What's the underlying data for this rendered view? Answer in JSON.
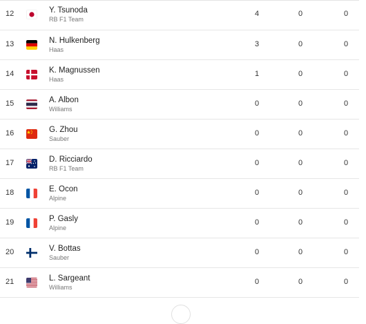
{
  "standings": {
    "rows": [
      {
        "pos": "12",
        "flag": "japan-flag-icon",
        "driver": "Y. Tsunoda",
        "team": "RB F1 Team",
        "s1": "4",
        "s2": "0",
        "s3": "0"
      },
      {
        "pos": "13",
        "flag": "germany-flag-icon",
        "driver": "N. Hulkenberg",
        "team": "Haas",
        "s1": "3",
        "s2": "0",
        "s3": "0"
      },
      {
        "pos": "14",
        "flag": "denmark-flag-icon",
        "driver": "K. Magnussen",
        "team": "Haas",
        "s1": "1",
        "s2": "0",
        "s3": "0"
      },
      {
        "pos": "15",
        "flag": "thailand-flag-icon",
        "driver": "A. Albon",
        "team": "Williams",
        "s1": "0",
        "s2": "0",
        "s3": "0"
      },
      {
        "pos": "16",
        "flag": "china-flag-icon",
        "driver": "G. Zhou",
        "team": "Sauber",
        "s1": "0",
        "s2": "0",
        "s3": "0"
      },
      {
        "pos": "17",
        "flag": "australia-flag-icon",
        "driver": "D. Ricciardo",
        "team": "RB F1 Team",
        "s1": "0",
        "s2": "0",
        "s3": "0"
      },
      {
        "pos": "18",
        "flag": "france-flag-icon",
        "driver": "E. Ocon",
        "team": "Alpine",
        "s1": "0",
        "s2": "0",
        "s3": "0"
      },
      {
        "pos": "19",
        "flag": "france-flag-icon",
        "driver": "P. Gasly",
        "team": "Alpine",
        "s1": "0",
        "s2": "0",
        "s3": "0"
      },
      {
        "pos": "20",
        "flag": "finland-flag-icon",
        "driver": "V. Bottas",
        "team": "Sauber",
        "s1": "0",
        "s2": "0",
        "s3": "0"
      },
      {
        "pos": "21",
        "flag": "usa-flag-icon",
        "driver": "L. Sargeant",
        "team": "Williams",
        "s1": "0",
        "s2": "0",
        "s3": "0"
      }
    ]
  },
  "colors": {
    "row_divider": "#e6e6e6",
    "driver_text": "#222222",
    "team_text": "#777777"
  }
}
